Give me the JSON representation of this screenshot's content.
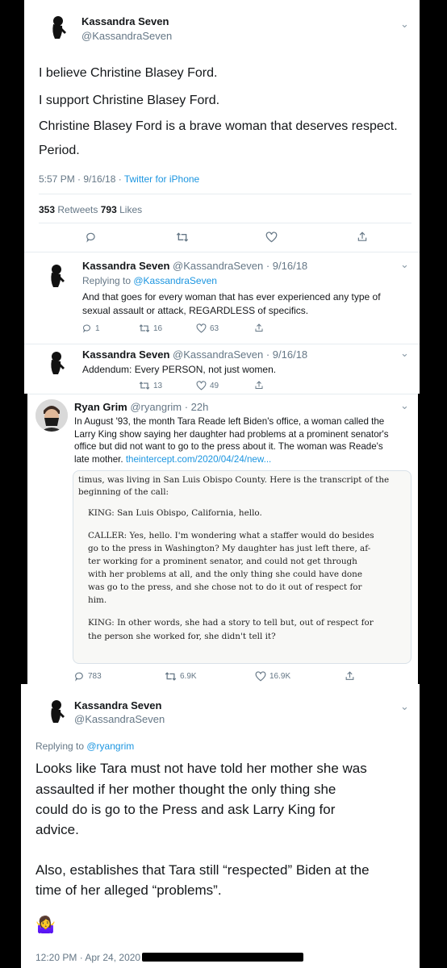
{
  "tweet1": {
    "name": "Kassandra Seven",
    "handle": "@KassandraSeven",
    "lines": [
      "I believe Christine Blasey Ford.",
      "I support Christine Blasey Ford.",
      "Christine Blasey Ford is a brave woman that deserves respect.",
      "Period."
    ],
    "time": "5:57 PM · 9/16/18 · ",
    "source": "Twitter for iPhone",
    "retweets": "353",
    "retweets_label": " Retweets ",
    "likes": "793",
    "likes_label": " Likes"
  },
  "reply1": {
    "name": "Kassandra Seven",
    "meta": " @KassandraSeven · 9/16/18",
    "replying_prefix": "Replying to ",
    "replying_handle": "@KassandraSeven",
    "lines": [
      "And that goes for every woman that has ever experienced any type of",
      "sexual assault or attack, REGARDLESS of specifics."
    ],
    "replies": "1",
    "retweets": "16",
    "likes": "63"
  },
  "reply2": {
    "name": "Kassandra Seven",
    "meta": " @KassandraSeven · 9/16/18",
    "text": "Addendum: Every PERSON, not just women.",
    "retweets": "13",
    "likes": "49"
  },
  "quoted": {
    "name": "Ryan Grim",
    "meta": " @ryangrim · 22h",
    "lines": [
      "In August '93, the month Tara Reade left Biden's office, a woman called the",
      "Larry King show saying her daughter had problems at a prominent senator's",
      "office but did not want to go to the press about it. The woman was Reade's"
    ],
    "last_line": "late mother. ",
    "link": "theintercept.com/2020/04/24/new...",
    "transcript": [
      "timus, was living in San Luis Obispo County. Here is the transcript of the",
      "beginning of the call:",
      "KING: San Luis Obispo, California, hello.",
      "CALLER: Yes, hello. I'm wondering what a staffer would do besides",
      "go to the press in Washington? My daughter has just left there, af-",
      "ter working for a prominent senator, and could not get through",
      "with her problems at all, and the only thing she could have done",
      "was go to the press, and she chose not to do it out of respect for",
      "him.",
      "KING: In other words, she had a story to tell but, out of respect for",
      "the person she worked for, she didn't tell it?"
    ],
    "replies": "783",
    "retweets": "6.9K",
    "likes": "16.9K"
  },
  "tweet2": {
    "name": "Kassandra Seven",
    "handle": "@KassandraSeven",
    "replying_prefix": "Replying to ",
    "replying_handle": "@ryangrim",
    "lines": [
      "Looks like Tara must not have told her mother she was",
      "assaulted if her mother thought the only thing she",
      "could do is go to the Press and ask Larry King for",
      "advice.",
      "Also, establishes that Tara still “respected” Biden at the",
      "time of her alleged “problems”."
    ],
    "emoji": "🤷‍♀️",
    "time": "12:20 PM · Apr 24, 2020 · "
  },
  "colors": {
    "link": "#1b95e0",
    "muted": "#657786"
  }
}
